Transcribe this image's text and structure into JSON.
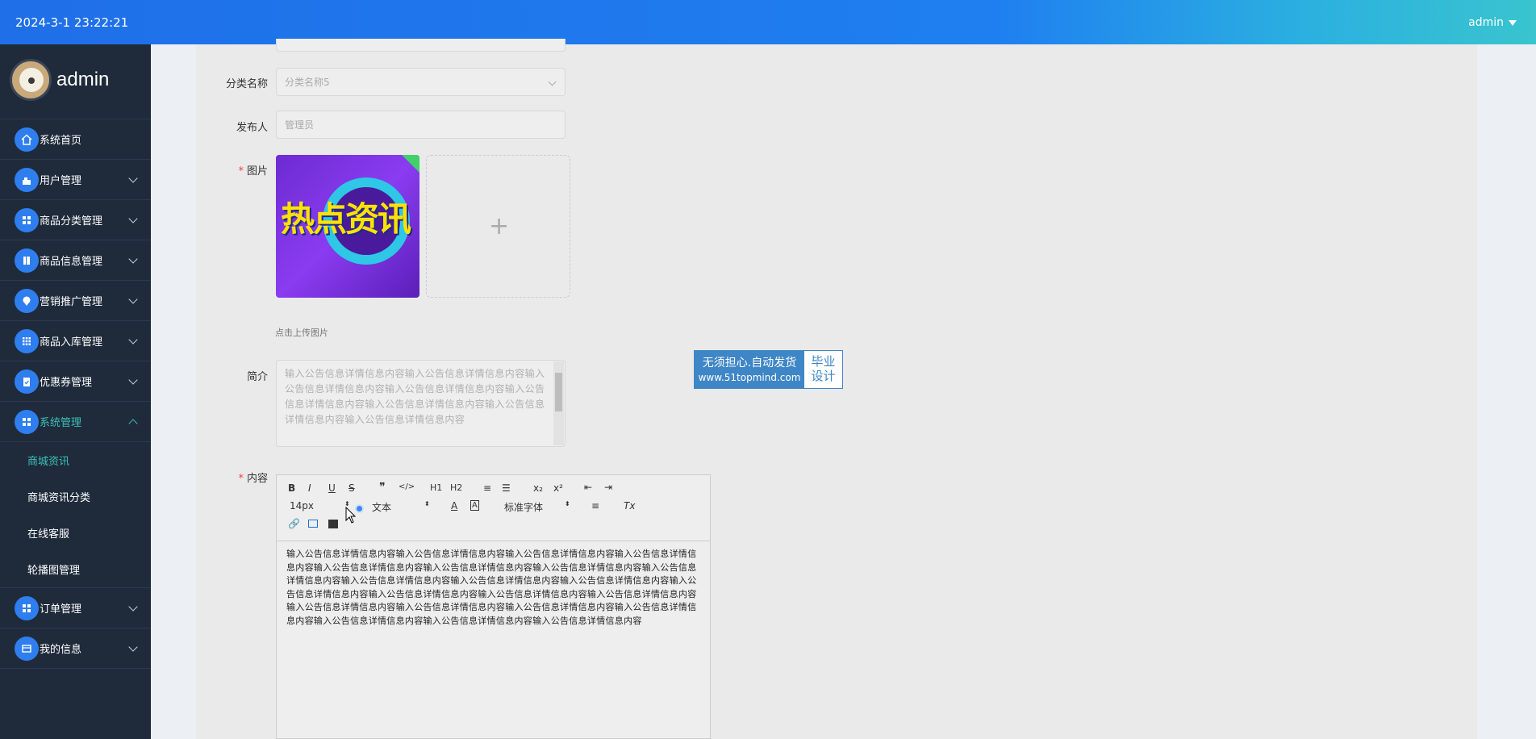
{
  "header": {
    "datetime": "2024-3-1 23:22:21",
    "user": "admin"
  },
  "sidebar": {
    "brand": "admin",
    "items": [
      {
        "label": "系统首页",
        "icon": "home-icon"
      },
      {
        "label": "用户管理",
        "icon": "user-icon"
      },
      {
        "label": "商品分类管理",
        "icon": "grid-icon"
      },
      {
        "label": "商品信息管理",
        "icon": "book-icon"
      },
      {
        "label": "营销推广管理",
        "icon": "pin-icon"
      },
      {
        "label": "商品入库管理",
        "icon": "apps-icon"
      },
      {
        "label": "优惠券管理",
        "icon": "clipboard-icon"
      },
      {
        "label": "系统管理",
        "icon": "grid-icon"
      },
      {
        "label": "订单管理",
        "icon": "grid-icon"
      },
      {
        "label": "我的信息",
        "icon": "card-icon"
      }
    ],
    "submenu": [
      "商城资讯",
      "商城资讯分类",
      "在线客服",
      "轮播图管理"
    ]
  },
  "form": {
    "category_label": "分类名称",
    "category_placeholder": "分类名称5",
    "publisher_label": "发布人",
    "publisher_value": "管理员",
    "image_label": "图片",
    "image_text": "热点资讯",
    "upload_hint": "点击上传图片",
    "intro_label": "简介",
    "intro_text": "输入公告信息详情信息内容输入公告信息详情信息内容输入公告信息详情信息内容输入公告信息详情信息内容输入公告信息详情信息内容输入公告信息详情信息内容输入公告信息详情信息内容输入公告信息详情信息内容",
    "content_label": "内容",
    "content_text": "输入公告信息详情信息内容输入公告信息详情信息内容输入公告信息详情信息内容输入公告信息详情信息内容输入公告信息详情信息内容输入公告信息详情信息内容输入公告信息详情信息内容输入公告信息详情信息内容输入公告信息详情信息内容输入公告信息详情信息内容输入公告信息详情信息内容输入公告信息详情信息内容输入公告信息详情信息内容输入公告信息详情信息内容输入公告信息详情信息内容输入公告信息详情信息内容输入公告信息详情信息内容输入公告信息详情信息内容输入公告信息详情信息内容输入公告信息详情信息内容输入公告信息详情信息内容输入公告信息详情信息内容"
  },
  "editor": {
    "font_size": "14px",
    "block_type": "文本",
    "font_family": "标准字体",
    "buttons": [
      "B",
      "I",
      "U",
      "S",
      "❞",
      "</>",
      "H1",
      "H2",
      "x₂",
      "x²",
      "Tx"
    ]
  },
  "watermark": {
    "line1": "无须担心.自动发货",
    "url": "www.51topmind.com",
    "right1": "毕业",
    "right2": "设计"
  }
}
